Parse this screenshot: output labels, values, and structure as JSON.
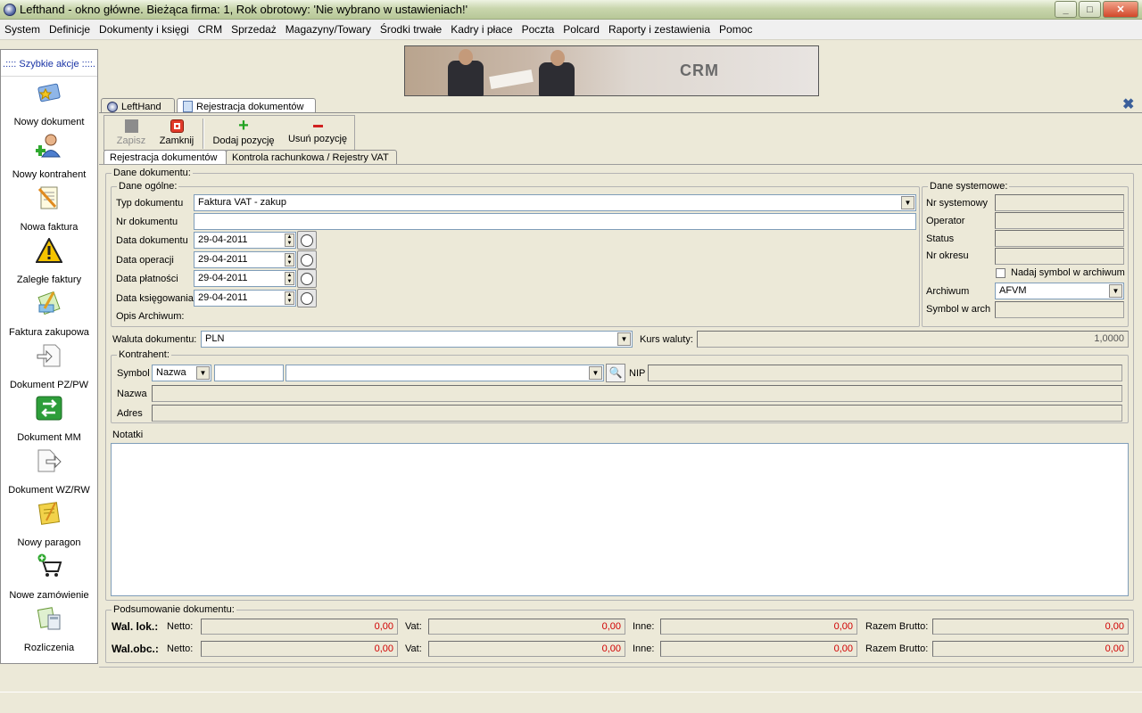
{
  "window": {
    "title": "Lefthand - okno główne. Bieżąca firma: 1, Rok obrotowy: 'Nie wybrano w ustawieniach!'",
    "minimize": "_",
    "maximize": "□",
    "close": "✕"
  },
  "menu": [
    "System",
    "Definicje",
    "Dokumenty i księgi",
    "CRM",
    "Sprzedaż",
    "Magazyny/Towary",
    "Środki trwałe",
    "Kadry i płace",
    "Poczta",
    "Polcard",
    "Raporty i zestawienia",
    "Pomoc"
  ],
  "sidebar": {
    "header": ".:::: Szybkie akcje ::::.",
    "items": [
      {
        "label": "Nowy dokument",
        "icon": "new-document-icon"
      },
      {
        "label": "Nowy kontrahent",
        "icon": "new-contractor-icon"
      },
      {
        "label": "Nowa faktura",
        "icon": "new-invoice-icon"
      },
      {
        "label": "Zaległe faktury",
        "icon": "warning-icon"
      },
      {
        "label": "Faktura zakupowa",
        "icon": "purchase-invoice-icon"
      },
      {
        "label": "Dokument PZ/PW",
        "icon": "document-in-icon"
      },
      {
        "label": "Dokument MM",
        "icon": "transfer-icon"
      },
      {
        "label": "Dokument WZ/RW",
        "icon": "document-out-icon"
      },
      {
        "label": "Nowy paragon",
        "icon": "receipt-icon"
      },
      {
        "label": "Nowe zamówienie",
        "icon": "cart-icon"
      },
      {
        "label": "Rozliczenia",
        "icon": "settlements-icon"
      }
    ]
  },
  "banner": {
    "text": "CRM"
  },
  "tabs": {
    "main": [
      "LeftHand",
      "Rejestracja dokumentów"
    ],
    "inner": [
      "Rejestracja dokumentów",
      "Kontrola rachunkowa / Rejestry VAT"
    ]
  },
  "toolbar": {
    "save": "Zapisz",
    "close": "Zamknij",
    "add_item": "Dodaj pozycję",
    "remove_item": "Usuń pozycję"
  },
  "document": {
    "group_label": "Dane dokumentu:",
    "general": {
      "label": "Dane ogólne:",
      "type_label": "Typ dokumentu",
      "type_value": "Faktura VAT - zakup",
      "number_label": "Nr dokumentu",
      "number_value": "",
      "doc_date_label": "Data dokumentu",
      "doc_date": "29-04-2011",
      "op_date_label": "Data operacji",
      "op_date": "29-04-2011",
      "pay_date_label": "Data płatności",
      "pay_date": "29-04-2011",
      "book_date_label": "Data księgowania",
      "book_date": "29-04-2011",
      "archive_desc_label": "Opis Archiwum:"
    },
    "system": {
      "label": "Dane systemowe:",
      "sys_no_label": "Nr systemowy",
      "operator_label": "Operator",
      "status_label": "Status",
      "period_label": "Nr okresu",
      "assign_symbol_label": "Nadaj symbol w archiwum",
      "archive_label": "Archiwum",
      "archive_value": "AFVM",
      "archive_symbol_label": "Symbol w arch"
    },
    "currency_label": "Waluta dokumentu:",
    "currency_value": "PLN",
    "rate_label": "Kurs waluty:",
    "rate_value": "1,0000"
  },
  "contractor": {
    "label": "Kontrahent:",
    "symbol_label": "Symbol",
    "symbol_mode": "Nazwa",
    "nip_label": "NIP",
    "name_label": "Nazwa",
    "address_label": "Adres"
  },
  "notes_label": "Notatki",
  "summary": {
    "label": "Podsumowanie dokumentu:",
    "rows": [
      {
        "label": "Wal. lok.:",
        "netto_label": "Netto:",
        "netto": "0,00",
        "vat_label": "Vat:",
        "vat": "0,00",
        "other_label": "Inne:",
        "other": "0,00",
        "gross_label": "Razem Brutto:",
        "gross": "0,00"
      },
      {
        "label": "Wal.obc.:",
        "netto_label": "Netto:",
        "netto": "0,00",
        "vat_label": "Vat:",
        "vat": "0,00",
        "other_label": "Inne:",
        "other": "0,00",
        "gross_label": "Razem Brutto:",
        "gross": "0,00"
      }
    ]
  }
}
